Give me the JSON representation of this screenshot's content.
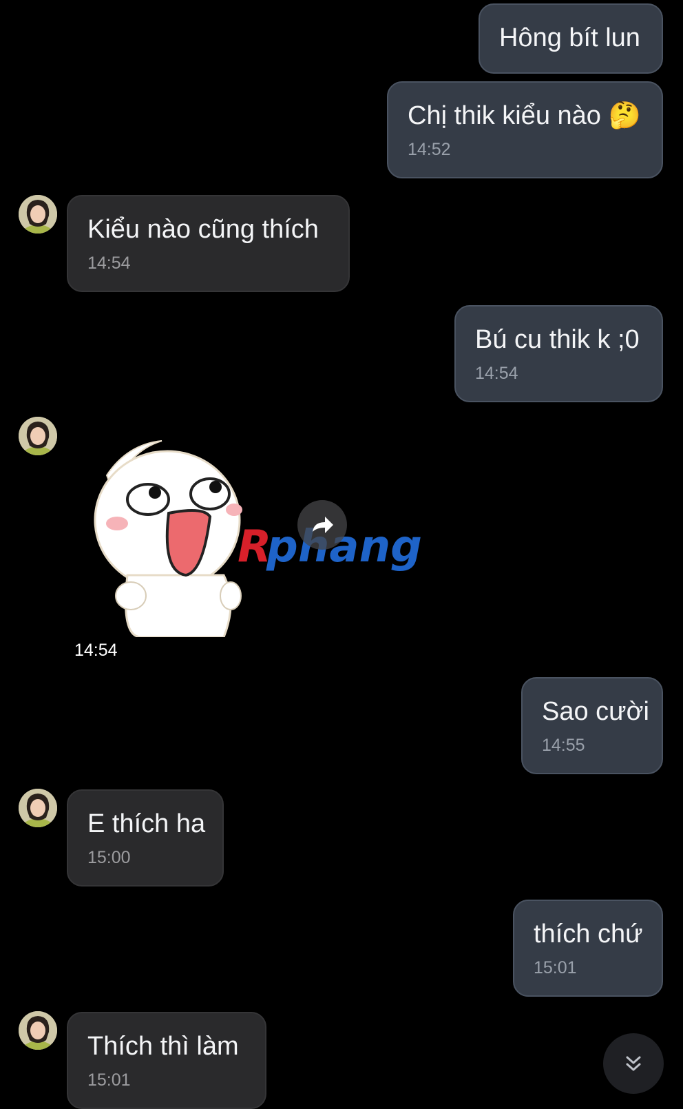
{
  "messages": [
    {
      "text": "Hông bít lun",
      "time": ""
    },
    {
      "text": "Chị thik kiểu nào 🤔",
      "time": "14:52"
    },
    {
      "text": "Kiểu nào cũng thích",
      "time": "14:54"
    },
    {
      "text": "Bú cu thik k ;0",
      "time": "14:54"
    },
    {
      "sticker_time": "14:54"
    },
    {
      "text": "Sao cười",
      "time": "14:55"
    },
    {
      "text": "E thích ha",
      "time": "15:00"
    },
    {
      "text": "thích chứ",
      "time": "15:01"
    },
    {
      "text": "Thích thì làm",
      "time": "15:01"
    }
  ],
  "watermark": "Rphang",
  "icons": {
    "forward": "forward-arrow-icon",
    "scroll_down": "double-chevron-down-icon",
    "avatar": "contact-avatar"
  },
  "colors": {
    "background": "#000000",
    "sent_bubble": "#353c47",
    "received_bubble": "#2a2a2c",
    "time_text": "#9aa1ab",
    "watermark_red": "#d8202a",
    "watermark_blue": "#1e63c8"
  }
}
